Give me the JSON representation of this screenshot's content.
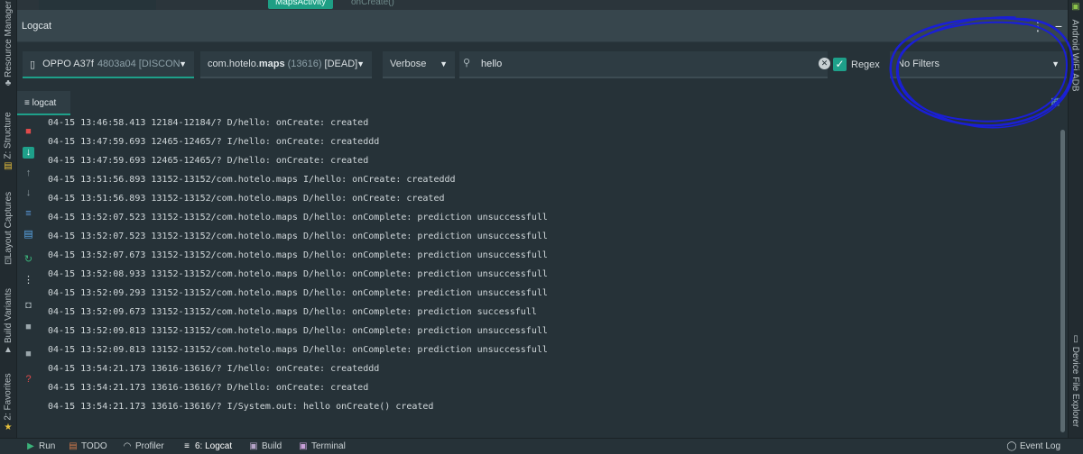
{
  "editor": {
    "active_tab": "MapsActivity",
    "method": "onCreate()"
  },
  "logcat": {
    "title": "Logcat",
    "device": {
      "name": "OPPO A37f",
      "serial": "4803a04",
      "status": "[DISCON"
    },
    "process": {
      "package_prefix": "com.hotelo.",
      "package_bold": "maps",
      "pid": "(13616)",
      "state": "[DEAD]"
    },
    "level": "Verbose",
    "search": {
      "value": "hello"
    },
    "regex_label": "Regex",
    "filter": "No Filters",
    "tab_label": "logcat",
    "lines": [
      "04-15 13:46:58.413 12184-12184/? D/hello: onCreate: created",
      "04-15 13:47:59.693 12465-12465/? I/hello: onCreate: createddd",
      "04-15 13:47:59.693 12465-12465/? D/hello: onCreate: created",
      "04-15 13:51:56.893 13152-13152/com.hotelo.maps I/hello: onCreate: createddd",
      "04-15 13:51:56.893 13152-13152/com.hotelo.maps D/hello: onCreate: created",
      "04-15 13:52:07.523 13152-13152/com.hotelo.maps D/hello: onComplete: prediction unsuccessfull",
      "04-15 13:52:07.523 13152-13152/com.hotelo.maps D/hello: onComplete: prediction unsuccessfull",
      "04-15 13:52:07.673 13152-13152/com.hotelo.maps D/hello: onComplete: prediction unsuccessfull",
      "04-15 13:52:08.933 13152-13152/com.hotelo.maps D/hello: onComplete: prediction unsuccessfull",
      "04-15 13:52:09.293 13152-13152/com.hotelo.maps D/hello: onComplete: prediction unsuccessfull",
      "04-15 13:52:09.673 13152-13152/com.hotelo.maps D/hello: onComplete: prediction successfull",
      "04-15 13:52:09.813 13152-13152/com.hotelo.maps D/hello: onComplete: prediction unsuccessfull",
      "04-15 13:52:09.813 13152-13152/com.hotelo.maps D/hello: onComplete: prediction unsuccessfull",
      "04-15 13:54:21.173 13616-13616/? I/hello: onCreate: createddd",
      "04-15 13:54:21.173 13616-13616/? D/hello: onCreate: created",
      "04-15 13:54:21.173 13616-13616/? I/System.out: hello onCreate() created"
    ]
  },
  "left_stripe": [
    "Resource Manager",
    "Z: Structure",
    "Layout Captures",
    "Build Variants",
    "2: Favorites"
  ],
  "right_stripe": [
    "Android WiFi ADB",
    "Device File Explorer"
  ],
  "bottom_tabs": [
    {
      "label": "Run",
      "icon": "run-icon"
    },
    {
      "label": "TODO",
      "icon": "todo-icon"
    },
    {
      "label": "Profiler",
      "icon": "profiler-icon"
    },
    {
      "label": "6: Logcat",
      "icon": "logcat-icon"
    },
    {
      "label": "Build",
      "icon": "build-icon"
    },
    {
      "label": "Terminal",
      "icon": "terminal-icon"
    }
  ],
  "event_log": "Event Log",
  "colors": {
    "accent": "#1ea08a",
    "annotation": "#1a1fd6",
    "background": "#263238"
  }
}
